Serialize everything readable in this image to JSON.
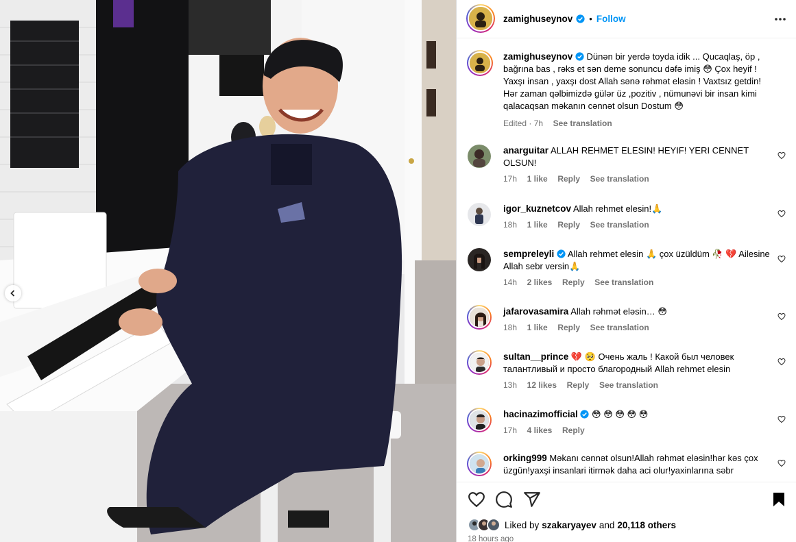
{
  "header": {
    "username": "zamighuseynov",
    "dot": "•",
    "follow_label": "Follow"
  },
  "caption": {
    "username": "zamighuseynov",
    "text": "Dünən bir yerdə toyda idik ... Qucaqlaş, öp , bağrına bas , rəks et sən deme sonuncu dəfə imiş 😳 Çox heyif ! Yaxşı insan , yaxşı dost Allah sənə rəhmət eləsin ! Vaxtsız getdin! Hər zaman qəlbimizdə gülər üz ,pozitiv , nümunəvi bir insan kimi qalacaqsan məkanın cənnət olsun Dostum 😳",
    "edited": "Edited · 7h",
    "see_translation": "See translation"
  },
  "comments": [
    {
      "username": "anarguitar",
      "text": "ALLAH REHMET ELESIN! HEYIF! YERI CENNET OLSUN!",
      "time": "17h",
      "likes": "1 like",
      "reply": "Reply",
      "see_translation": "See translation",
      "verified": false
    },
    {
      "username": "igor_kuznetcov",
      "text": "Allah rehmet elesin!🙏",
      "time": "18h",
      "likes": "1 like",
      "reply": "Reply",
      "see_translation": "See translation",
      "verified": false
    },
    {
      "username": "sempreleyli",
      "text": "Allah rehmet elesin 🙏 çox üzüldüm 🥀 💔 Ailesine Allah sebr versin🙏",
      "time": "14h",
      "likes": "2 likes",
      "reply": "Reply",
      "see_translation": "See translation",
      "verified": true
    },
    {
      "username": "jafarovasamira",
      "text": "Allah rəhmət eləsin… 😳",
      "time": "18h",
      "likes": "1 like",
      "reply": "Reply",
      "see_translation": "See translation",
      "verified": false
    },
    {
      "username": "sultan__prince",
      "text": "💔 🥺 Очень жаль ! Какой был человек талантливый и просто благородный Allah rehmet elesin",
      "time": "13h",
      "likes": "12 likes",
      "reply": "Reply",
      "see_translation": "See translation",
      "verified": false
    },
    {
      "username": "hacinazimofficial",
      "text": "😳 😳 😳 😳 😳",
      "time": "17h",
      "likes": "4 likes",
      "reply": "Reply",
      "see_translation": "",
      "verified": true
    },
    {
      "username": "orking999",
      "text": "Məkanı cənnət olsun!Allah rəhmət eləsin!hər kəs çox üzgün!yaxşi insanlari itirmək daha aci olur!yaxinlarına səbr",
      "time": "",
      "likes": "",
      "reply": "",
      "see_translation": "",
      "verified": false
    }
  ],
  "likes": {
    "prefix": "Liked by",
    "user": "szakaryayev",
    "and": "and",
    "count": "20,118 others"
  },
  "time_ago": "18 hours ago",
  "icons": [
    "more-icon",
    "verified-badge-icon",
    "heart-icon",
    "comment-icon",
    "share-icon",
    "bookmark-icon",
    "chevron-left-icon"
  ],
  "colors": {
    "link_blue": "#0095f6",
    "verified_blue": "#0095f6",
    "muted": "#737373"
  }
}
